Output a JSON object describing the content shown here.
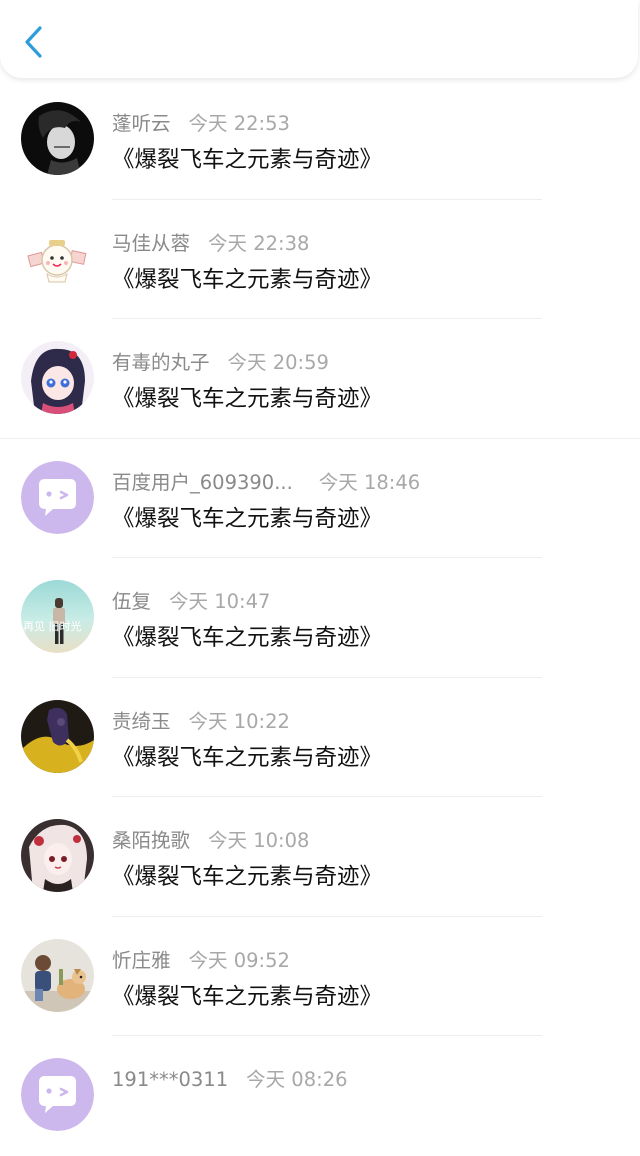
{
  "header": {
    "back_icon": "chevron-left-icon",
    "accent": "#2d9cdb"
  },
  "items": [
    {
      "name": "蓬听云",
      "time": "今天 22:53",
      "content": "《爆裂飞车之元素与奇迹》",
      "avatar": "dark-portrait"
    },
    {
      "name": "马佳从蓉",
      "time": "今天 22:38",
      "content": "《爆裂飞车之元素与奇迹》",
      "avatar": "cartoon-sticker"
    },
    {
      "name": "有毒的丸子",
      "time": "今天 20:59",
      "content": "《爆裂飞车之元素与奇迹》",
      "avatar": "anime-girl"
    },
    {
      "name": "百度用户_609390...",
      "time": "今天 18:46",
      "content": "《爆裂飞车之元素与奇迹》",
      "avatar": "default-chat-icon"
    },
    {
      "name": "伍复",
      "time": "今天 10:47",
      "content": "《爆裂飞车之元素与奇迹》",
      "avatar": "beach-photo",
      "avatar_text": "再见 旧时光"
    },
    {
      "name": "责绮玉",
      "time": "今天 10:22",
      "content": "《爆裂飞车之元素与奇迹》",
      "avatar": "yellow-figure"
    },
    {
      "name": "桑陌挽歌",
      "time": "今天 10:08",
      "content": "《爆裂飞车之元素与奇迹》",
      "avatar": "anime-doll"
    },
    {
      "name": "忻庄雅",
      "time": "今天 09:52",
      "content": "《爆裂飞车之元素与奇迹》",
      "avatar": "child-with-dog"
    },
    {
      "name": "191***0311",
      "time": "今天 08:26",
      "content": "",
      "avatar": "default-chat-icon"
    }
  ],
  "colors": {
    "default_avatar": "#cdb8ee",
    "name": "#8a8a8a",
    "time": "#a8a8a8",
    "content": "#111111"
  }
}
